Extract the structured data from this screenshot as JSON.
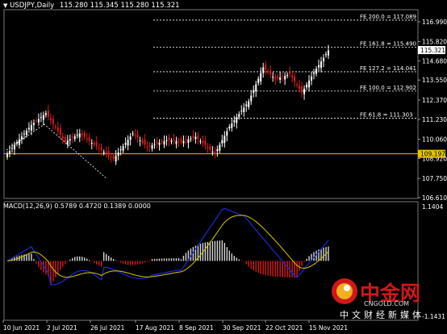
{
  "header": {
    "symbol_timeframe": "USDJPY,Daily",
    "ohlc": "115.280 115.345 115.280 115.321"
  },
  "macd": {
    "label": "MACD(12,26,9) 0.5789 0.4720 0.1389 0.0000",
    "scale_top": "1.1404",
    "scale_bottom": "-1.1431"
  },
  "price_axis": {
    "labels": [
      "116.990",
      "115.820",
      "114.680",
      "113.550",
      "112.370",
      "111.230",
      "110.060",
      "108.920",
      "107.750",
      "106.610"
    ],
    "current_price": "115.321",
    "line_price": "109.197"
  },
  "date_axis": {
    "labels": [
      "10 Jun 2021",
      "2 Jul 2021",
      "26 Jul 2021",
      "17 Aug 2021",
      "8 Sep 2021",
      "30 Sep 2021",
      "22 Oct 2021",
      "15 Nov 2021"
    ]
  },
  "fibo_levels": [
    {
      "label": "FE 200.0 = 117.089"
    },
    {
      "label": "FE 161.8 = 115.490"
    },
    {
      "label": "FE 127.2 = 114.041"
    },
    {
      "label": "FE 100.0 = 112.902"
    },
    {
      "label": "FE 61.8 = 111.303"
    }
  ],
  "watermark": {
    "brand": "中金网",
    "url": "CNGOLD.COM",
    "slogan": "中文财经新媒体"
  },
  "colors": {
    "bull": "#ffffff",
    "bear": "#d81c1c",
    "grid": "#3c3c3c",
    "fibo": "#ffffff",
    "hline": "#e6c200",
    "macd_line": "#1a2bd8",
    "signal_line": "#d8c800",
    "hist_pos": "#d8d8d8",
    "hist_neg": "#d81c1c"
  }
}
